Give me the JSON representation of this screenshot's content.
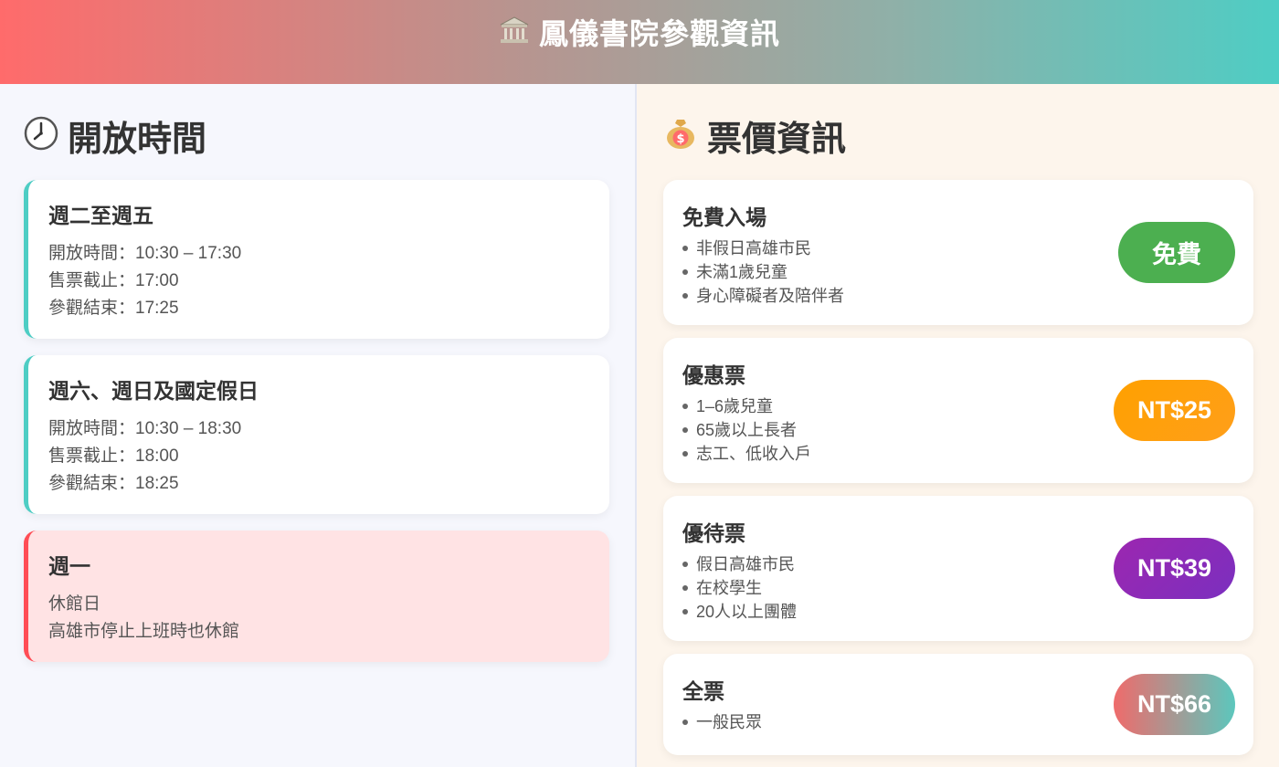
{
  "header": {
    "title": "鳳儀書院參觀資訊",
    "icon": "classical-building-icon"
  },
  "hours": {
    "title": "開放時間",
    "icon": "clock-icon",
    "cards": [
      {
        "title": "週二至週五",
        "lines": [
          "開放時間：10:30 – 17:30",
          "售票截止：17:00",
          "參觀結束：17:25"
        ]
      },
      {
        "title": "週六、週日及國定假日",
        "lines": [
          "開放時間：10:30 – 18:30",
          "售票截止：18:00",
          "參觀結束：18:25"
        ]
      },
      {
        "title": "週一",
        "lines": [
          "休館日",
          "高雄市停止上班時也休館"
        ]
      }
    ]
  },
  "tickets": {
    "title": "票價資訊",
    "icon": "money-bag-icon",
    "cards": [
      {
        "name": "免費入場",
        "items": [
          "非假日高雄市民",
          "未滿1歲兒童",
          "身心障礙者及陪伴者"
        ],
        "price": "免費",
        "color": "#4caf50"
      },
      {
        "name": "優惠票",
        "items": [
          "1–6歲兒童",
          "65歲以上長者",
          "志工、低收入戶"
        ],
        "price": "NT$25",
        "color": "#ffa000"
      },
      {
        "name": "優待票",
        "items": [
          "假日高雄市民",
          "在校學生",
          "20人以上團體"
        ],
        "price": "NT$39",
        "color": "#8e24aa"
      },
      {
        "name": "全票",
        "items": [
          "一般民眾"
        ],
        "price": "NT$66",
        "color": "#ef6b6b"
      }
    ]
  }
}
